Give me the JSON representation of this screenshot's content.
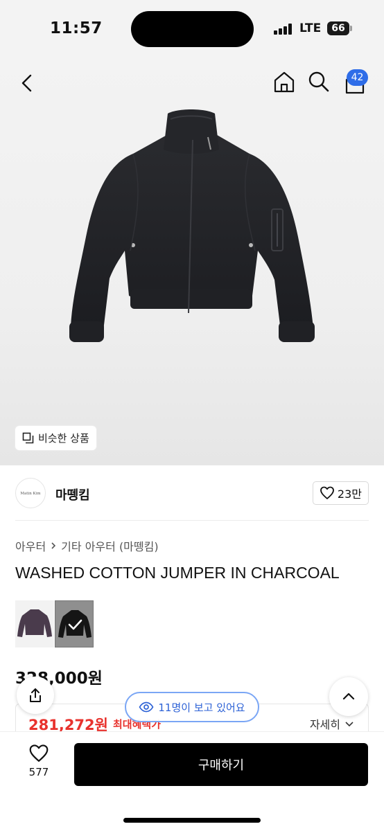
{
  "status_bar": {
    "time": "11:57",
    "network": "LTE",
    "battery": "66"
  },
  "header": {
    "cart_count": "42",
    "icons": [
      "back-icon",
      "home-icon",
      "search-icon",
      "cart-icon"
    ]
  },
  "hero": {
    "similar_label": "비슷한 상품"
  },
  "brand": {
    "logo_text": "Matin Kim",
    "name": "마뗑킴",
    "likes": "23만"
  },
  "breadcrumb": {
    "category": "아우터",
    "subcategory": "기타 아우터 (마뗑킴)"
  },
  "product": {
    "title": "WASHED COTTON JUMPER IN CHARCOAL",
    "original_price": "328,000원",
    "sale_price": "281,272원",
    "discount_label": "최대혜택가",
    "details_label": "자세히",
    "viewers": "11명이 보고 있어요"
  },
  "bottom_bar": {
    "wish_count": "577",
    "buy_label": "구매하기"
  },
  "colors": {
    "accent_blue": "#2e6de8",
    "sale_red": "#e8322d",
    "buy_black": "#000000"
  }
}
